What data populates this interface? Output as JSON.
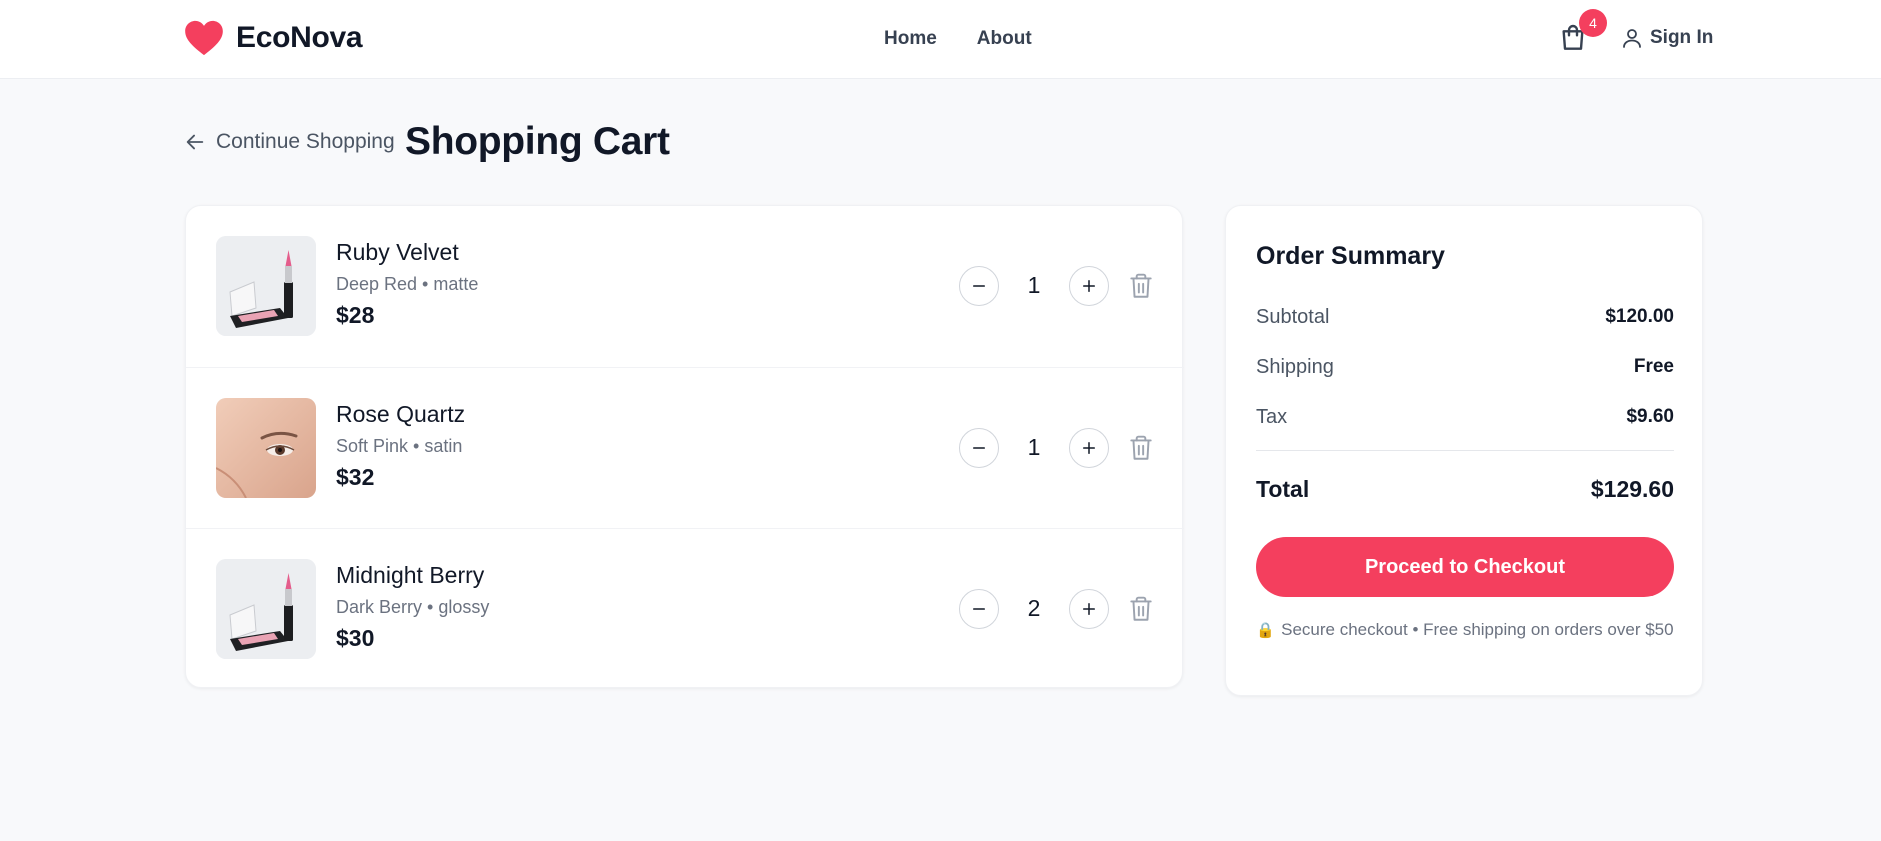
{
  "header": {
    "brand": "EcoNova",
    "nav": [
      {
        "label": "Home"
      },
      {
        "label": "About"
      }
    ],
    "cart_count": "4",
    "sign_in": "Sign In"
  },
  "page": {
    "back_label": "Continue Shopping",
    "title": "Shopping Cart"
  },
  "cart": {
    "items": [
      {
        "name": "Ruby Velvet",
        "variant": "Deep Red • matte",
        "price": "$28",
        "qty": "1",
        "image": "lipstick-compact-photo"
      },
      {
        "name": "Rose Quartz",
        "variant": "Soft Pink • satin",
        "price": "$32",
        "qty": "1",
        "image": "face-closeup-photo"
      },
      {
        "name": "Midnight Berry",
        "variant": "Dark Berry • glossy",
        "price": "$30",
        "qty": "2",
        "image": "lipstick-compact-photo"
      }
    ]
  },
  "summary": {
    "title": "Order Summary",
    "subtotal_label": "Subtotal",
    "subtotal": "$120.00",
    "shipping_label": "Shipping",
    "shipping": "Free",
    "tax_label": "Tax",
    "tax": "$9.60",
    "total_label": "Total",
    "total": "$129.60",
    "checkout_label": "Proceed to Checkout",
    "lock_icon": "🔒",
    "secure_note": "Secure checkout • Free shipping on orders over $50"
  },
  "colors": {
    "accent": "#f43f5e",
    "background": "#f8f9fb",
    "text": "#111827",
    "muted": "#6b7280"
  },
  "icons": [
    "heart-logo-icon",
    "shopping-bag-icon",
    "user-icon",
    "arrow-left-icon",
    "minus-icon",
    "plus-icon",
    "trash-icon",
    "lock-icon"
  ]
}
